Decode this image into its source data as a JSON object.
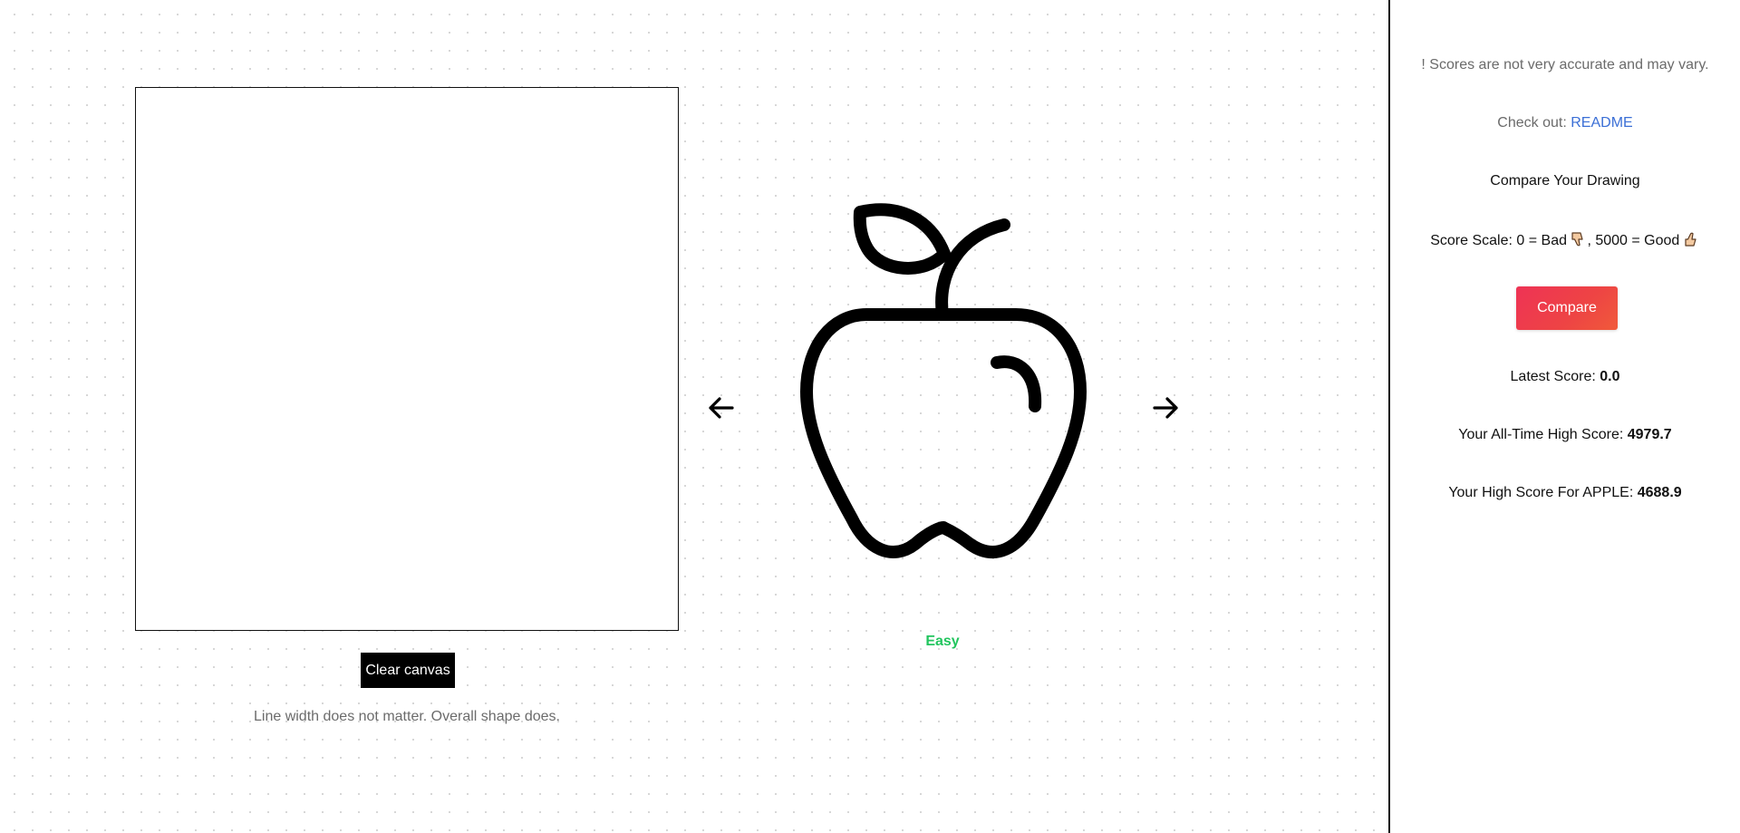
{
  "drawing": {
    "clear_label": "Clear canvas",
    "hint": "Line width does not matter. Overall shape does."
  },
  "target": {
    "icon": "apple-icon",
    "difficulty": "Easy",
    "difficulty_color": "#22c55e"
  },
  "sidebar": {
    "disclaimer": "! Scores are not very accurate and may vary.",
    "checkout_prefix": "Check out: ",
    "readme_label": "README",
    "compare_heading": "Compare Your Drawing",
    "scale_text_1": "Score Scale: 0 = Bad ",
    "scale_text_2": ", 5000 = Good ",
    "compare_label": "Compare",
    "latest_label": "Latest Score: ",
    "latest_value": "0.0",
    "alltime_label": "Your All-Time High Score: ",
    "alltime_value": "4979.7",
    "apple_label": "Your High Score For APPLE: ",
    "apple_value": "4688.9"
  },
  "colors": {
    "accent_red": "#ee3355",
    "link_blue": "#3b6fd6"
  }
}
